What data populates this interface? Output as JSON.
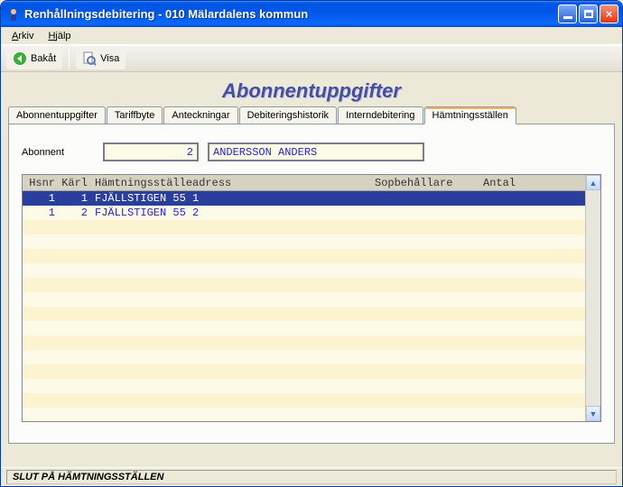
{
  "window": {
    "title": "Renhållningsdebitering  -  010 Mälardalens kommun"
  },
  "menu": {
    "items": [
      "Arkiv",
      "Hjälp"
    ]
  },
  "toolbar": {
    "back_label": "Bakåt",
    "show_label": "Visa"
  },
  "page_heading": "Abonnentuppgifter",
  "tabs": [
    {
      "label": "Abonnentuppgifter"
    },
    {
      "label": "Tariffbyte"
    },
    {
      "label": "Anteckningar"
    },
    {
      "label": "Debiteringshistorik"
    },
    {
      "label": "Interndebitering"
    },
    {
      "label": "Hämtningsställen"
    }
  ],
  "active_tab_index": 5,
  "form": {
    "abonnent_label": "Abonnent",
    "abonnent_id": "2",
    "abonnent_name": "ANDERSSON ANDERS"
  },
  "grid": {
    "columns": {
      "hsnr": "Hsnr",
      "karl": "Kärl",
      "addr": "Hämtningsställeadress",
      "sopb": "Sopbehållare",
      "antal": "Antal"
    },
    "rows": [
      {
        "hsnr": "1",
        "karl": "1",
        "addr": "FJÄLLSTIGEN 55 1",
        "sopb": "",
        "antal": "",
        "selected": true
      },
      {
        "hsnr": "1",
        "karl": "2",
        "addr": "FJÄLLSTIGEN 55 2",
        "sopb": "",
        "antal": "",
        "selected": false
      }
    ],
    "filler_rows": 14
  },
  "status": "SLUT PÅ HÄMTNINGSSTÄLLEN"
}
